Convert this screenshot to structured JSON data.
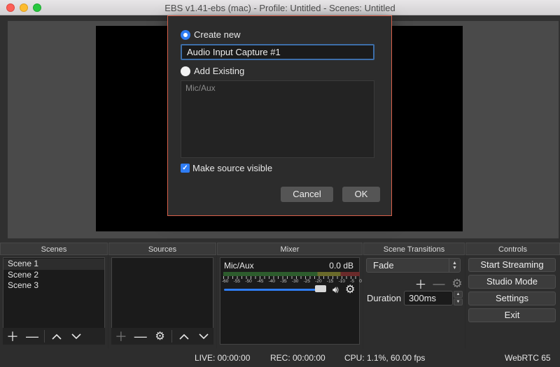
{
  "window": {
    "title": "EBS v1.41-ebs (mac) - Profile: Untitled - Scenes: Untitled"
  },
  "docks": {
    "scenes": {
      "title": "Scenes",
      "items": [
        "Scene 1",
        "Scene 2",
        "Scene 3"
      ],
      "selected_index": 0
    },
    "sources": {
      "title": "Sources"
    },
    "mixer": {
      "title": "Mixer",
      "channel_name": "Mic/Aux",
      "level": "0.0 dB",
      "scale": [
        "-60",
        "-55",
        "-50",
        "-45",
        "-40",
        "-35",
        "-30",
        "-25",
        "-20",
        "-15",
        "-10",
        "-5",
        "0"
      ],
      "volume_fraction": 0.95
    },
    "transitions": {
      "title": "Scene Transitions",
      "selected": "Fade",
      "duration_label": "Duration",
      "duration_value": "300ms"
    },
    "controls": {
      "title": "Controls",
      "buttons": [
        "Start Streaming",
        "Studio Mode",
        "Settings",
        "Exit"
      ]
    }
  },
  "status": {
    "live": "LIVE: 00:00:00",
    "rec": "REC: 00:00:00",
    "cpu": "CPU: 1.1%, 60.00 fps",
    "webrtc": "WebRTC 65"
  },
  "dialog": {
    "create_new_label": "Create new",
    "name_value": "Audio Input Capture #1",
    "add_existing_label": "Add Existing",
    "existing_items": [
      "Mic/Aux"
    ],
    "make_visible_label": "Make source visible",
    "make_visible_checked": true,
    "cancel_label": "Cancel",
    "ok_label": "OK"
  },
  "colors": {
    "accent": "#2f7df4",
    "dialog_border": "#d8604a"
  }
}
